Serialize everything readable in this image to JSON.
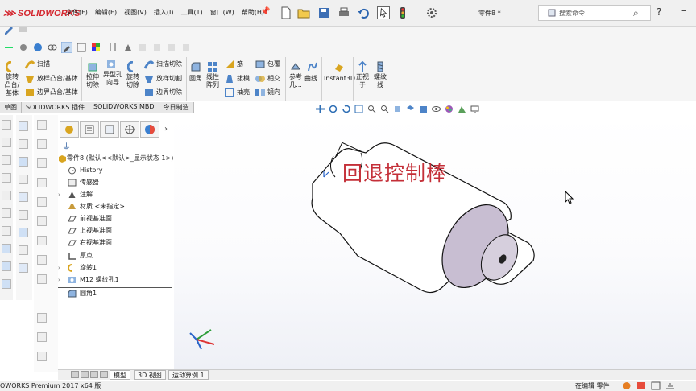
{
  "app": {
    "logo_text": "SOLIDWORKS",
    "document_name": "零件8 *",
    "search_placeholder": "搜索命令",
    "help_label": "?",
    "brand_color": "#d4262e"
  },
  "menu": {
    "items": [
      "文件(F)",
      "编辑(E)",
      "视图(V)",
      "插入(I)",
      "工具(T)",
      "窗口(W)",
      "帮助(H)"
    ]
  },
  "commands": {
    "revolve_boss": "旋转\n凸台/\n基体",
    "sweep": "扫描",
    "loft_boss": "放样凸台/基体",
    "boundary_boss": "边界凸台/基体",
    "extruded_cut": "拉伸\n切除",
    "hole_wizard": "异型孔\n向导",
    "revolved_cut": "旋转\n切除",
    "swept_cut": "扫描切除",
    "lofted_cut": "放样切割",
    "boundary_cut": "边界切除",
    "fillet": "圆角",
    "linear_pattern": "线性\n阵列",
    "rib": "筋",
    "draft": "拔模",
    "shell": "抽壳",
    "wrap": "包覆",
    "intersect": "相交",
    "mirror": "镜向",
    "reference_geometry": "参考\n几...",
    "curves": "曲线",
    "instant3d": "Instant3D",
    "normal_to": "正视\n于",
    "thread": "螺纹\n线"
  },
  "tabs": [
    "草图",
    "SOLIDWORKS 插件",
    "SOLIDWORKS MBD",
    "今日制造"
  ],
  "feature_tree": {
    "root": "零件8 (默认<<默认>_显示状态 1>)",
    "items": [
      {
        "label": "History",
        "expandable": false
      },
      {
        "label": "传感器",
        "expandable": false
      },
      {
        "label": "注解",
        "expandable": true
      },
      {
        "label": "材质 <未指定>",
        "expandable": false
      },
      {
        "label": "前视基准面",
        "expandable": false
      },
      {
        "label": "上视基准面",
        "expandable": false
      },
      {
        "label": "右视基准面",
        "expandable": false
      },
      {
        "label": "原点",
        "expandable": false
      },
      {
        "label": "旋转1",
        "expandable": true
      },
      {
        "label": "M12 螺纹孔1",
        "expandable": true
      },
      {
        "label": "圆角1",
        "expandable": false
      }
    ]
  },
  "bottom_tabs": [
    "模型",
    "3D 视图",
    "运动算例 1"
  ],
  "status": {
    "left": "OWORKS Premium 2017 x64 版",
    "right": "在编辑 零件"
  },
  "viewport": {
    "overlay_text": "回退控制棒",
    "part_face_color": "#c8bed2"
  }
}
